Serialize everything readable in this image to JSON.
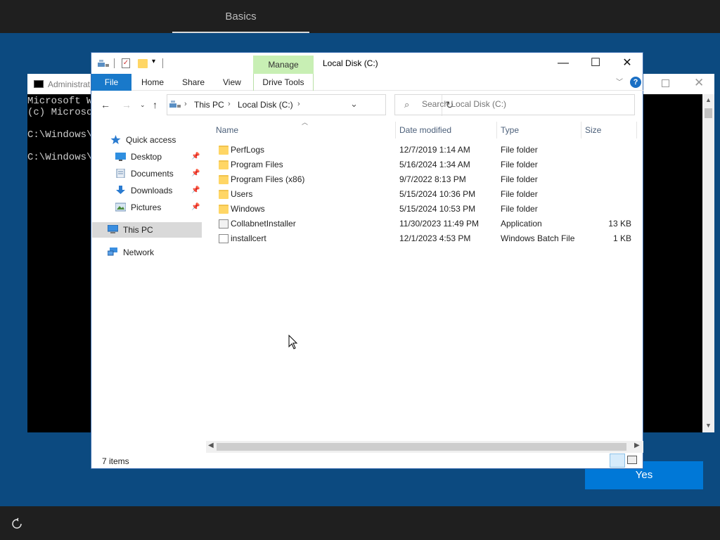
{
  "setup": {
    "tab": "Basics",
    "yes_label": "Yes"
  },
  "console": {
    "title": "Administrat",
    "lines": [
      "Microsoft W",
      "(c) Microso",
      "",
      "C:\\Windows\\s",
      "",
      "C:\\Windows\\s"
    ]
  },
  "explorer": {
    "title": "Local Disk (C:)",
    "context_tab": "Manage",
    "ribbon_tabs": {
      "file": "File",
      "home": "Home",
      "share": "Share",
      "view": "View",
      "drive_tools": "Drive Tools"
    },
    "address": {
      "seg1": "This PC",
      "seg2": "Local Disk (C:)"
    },
    "search_placeholder": "Search Local Disk (C:)",
    "nav": {
      "quick_access": "Quick access",
      "desktop": "Desktop",
      "documents": "Documents",
      "downloads": "Downloads",
      "pictures": "Pictures",
      "this_pc": "This PC",
      "network": "Network"
    },
    "columns": {
      "name": "Name",
      "date": "Date modified",
      "type": "Type",
      "size": "Size"
    },
    "files": [
      {
        "name": "PerfLogs",
        "date": "12/7/2019 1:14 AM",
        "type": "File folder",
        "size": "",
        "icon": "folder-icon"
      },
      {
        "name": "Program Files",
        "date": "5/16/2024 1:34 AM",
        "type": "File folder",
        "size": "",
        "icon": "folder-icon"
      },
      {
        "name": "Program Files (x86)",
        "date": "9/7/2022 8:13 PM",
        "type": "File folder",
        "size": "",
        "icon": "folder-icon"
      },
      {
        "name": "Users",
        "date": "5/15/2024 10:36 PM",
        "type": "File folder",
        "size": "",
        "icon": "folder-icon"
      },
      {
        "name": "Windows",
        "date": "5/15/2024 10:53 PM",
        "type": "File folder",
        "size": "",
        "icon": "folder-icon"
      },
      {
        "name": "CollabnetInstaller",
        "date": "11/30/2023 11:49 PM",
        "type": "Application",
        "size": "13 KB",
        "icon": "application-icon"
      },
      {
        "name": "installcert",
        "date": "12/1/2023 4:53 PM",
        "type": "Windows Batch File",
        "size": "1 KB",
        "icon": "batch-file-icon"
      }
    ],
    "status": "7 items"
  },
  "colors": {
    "setup_bg": "#0c4a80",
    "accent": "#0078d7",
    "file_tab": "#1979ca",
    "manage_tab": "#c8efb4"
  }
}
